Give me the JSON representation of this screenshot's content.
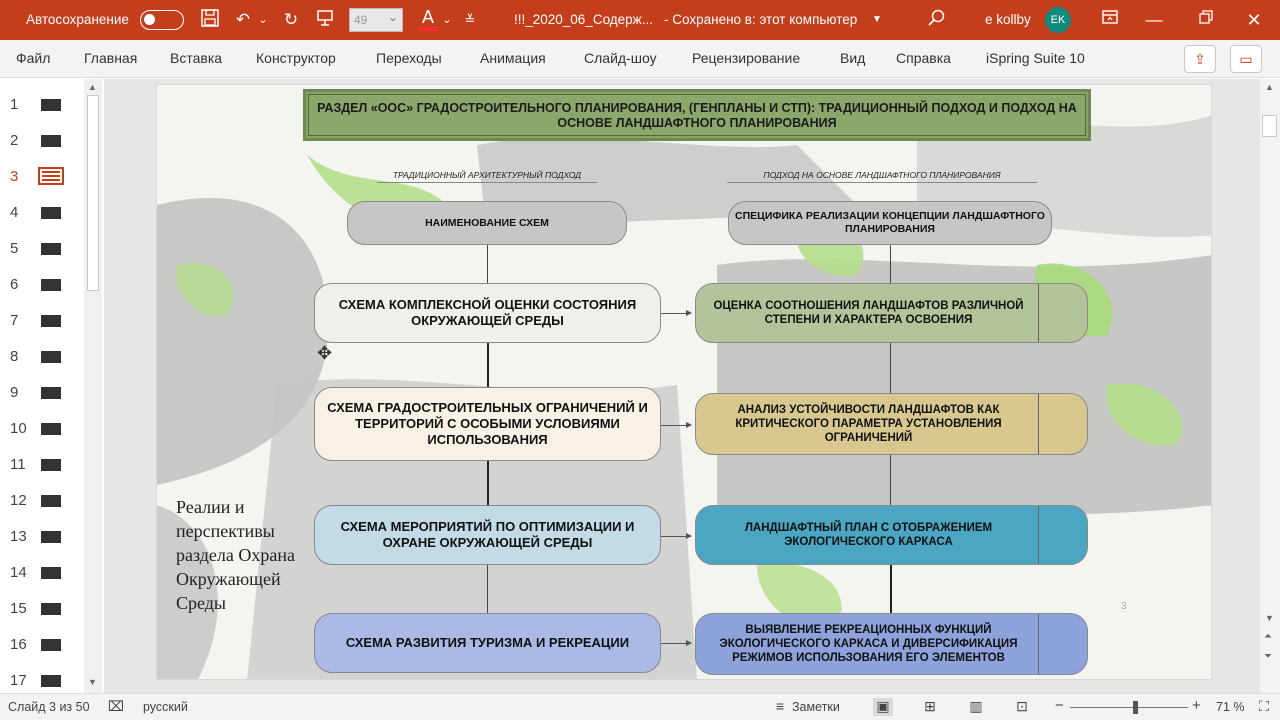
{
  "titlebar": {
    "autosave_label": "Автосохранение",
    "font_size": "49",
    "font_color_letter": "A",
    "doc_title": "!!!_2020_06_Содерж...",
    "saved_state": "-  Сохранено в: этот компьютер",
    "user_name": "e kollby",
    "avatar_initials": "EK",
    "font_color": "#ff2a2a"
  },
  "menu": {
    "items": [
      "Файл",
      "Главная",
      "Вставка",
      "Конструктор",
      "Переходы",
      "Анимация",
      "Слайд-шоу",
      "Рецензирование",
      "Вид",
      "Справка",
      "iSpring Suite 10"
    ]
  },
  "thumbnails": {
    "numbers": [
      "1",
      "2",
      "3",
      "4",
      "5",
      "6",
      "7",
      "8",
      "9",
      "10",
      "11",
      "12",
      "13",
      "14",
      "15",
      "16",
      "17"
    ],
    "active": "3"
  },
  "slide": {
    "heading": "РАЗДЕЛ «ООС» ГРАДОСТРОИТЕЛЬНОГО ПЛАНИРОВАНИЯ, (ГЕНПЛАНЫ И СТП): ТРАДИЦИОННЫЙ ПОДХОД И ПОДХОД НА ОСНОВЕ ЛАНДШАФТНОГО ПЛАНИРОВАНИЯ",
    "left_header": "ТРАДИЦИОННЫЙ АРХИТЕКТУРНЫЙ ПОДХОД",
    "right_header": "ПОДХОД НА ОСНОВЕ ЛАНДШАФТНОГО ПЛАНИРОВАНИЯ",
    "left_title_box": "НАИМЕНОВАНИЕ СХЕМ",
    "right_title_box": "СПЕЦИФИКА РЕАЛИЗАЦИИ КОНЦЕПЦИИ ЛАНДШАФТНОГО ПЛАНИРОВАНИЯ",
    "left_boxes": [
      "СХЕМА КОМПЛЕКСНОЙ ОЦЕНКИ СОСТОЯНИЯ ОКРУЖАЮЩЕЙ СРЕДЫ",
      "СХЕМА ГРАДОСТРОИТЕЛЬНЫХ ОГРАНИЧЕНИЙ И ТЕРРИТОРИЙ С ОСОБЫМИ УСЛОВИЯМИ ИСПОЛЬЗОВАНИЯ",
      "СХЕМА МЕРОПРИЯТИЙ ПО ОПТИМИЗАЦИИ И ОХРАНЕ ОКРУЖАЮЩЕЙ СРЕДЫ",
      "СХЕМА РАЗВИТИЯ ТУРИЗМА И РЕКРЕАЦИИ"
    ],
    "right_boxes": [
      "ОЦЕНКА СООТНОШЕНИЯ ЛАНДШАФТОВ РАЗЛИЧНОЙ СТЕПЕНИ И ХАРАКТЕРА ОСВОЕНИЯ",
      "АНАЛИЗ УСТОЙЧИВОСТИ ЛАНДШАФТОВ КАК КРИТИЧЕСКОГО ПАРАМЕТРА УСТАНОВЛЕНИЯ ОГРАНИЧЕНИЙ",
      "ЛАНДШАФТНЫЙ ПЛАН С ОТОБРАЖЕНИЕМ ЭКОЛОГИЧЕСКОГО КАРКАСА",
      "ВЫЯВЛЕНИЕ РЕКРЕАЦИОННЫХ ФУНКЦИЙ ЭКОЛОГИЧЕСКОГО КАРКАСА И ДИВЕРСИФИКАЦИЯ РЕЖИМОВ ИСПОЛЬЗОВАНИЯ ЕГО ЭЛЕМЕНТОВ"
    ],
    "left_colors": [
      "#f0f0ea",
      "#f8f2e6",
      "#c2dbe6",
      "#aab9e6"
    ],
    "right_colors": [
      "#b3c49a",
      "#d8c890",
      "#4aa6c2",
      "#8ea3dc"
    ],
    "side_text": "Реалии и перспективы раздела Охрана Окружающей Среды",
    "page_mark": "3"
  },
  "status": {
    "slide_info": "Слайд 3 из 50",
    "language": "русский",
    "notes_label": "Заметки",
    "zoom_minus": "−",
    "zoom_plus": "+",
    "zoom_level": "71 %",
    "zoom_fraction": 0.55
  }
}
